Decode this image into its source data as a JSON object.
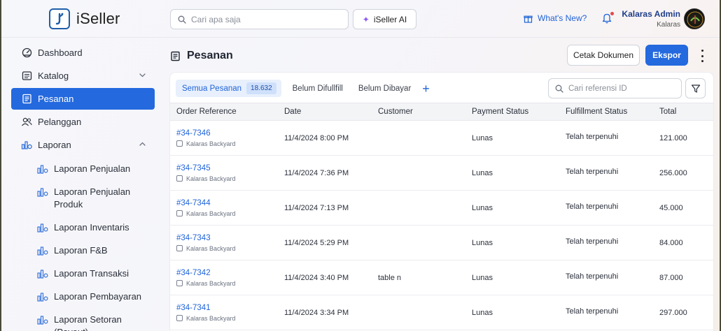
{
  "header": {
    "brand": "iSeller",
    "search_placeholder": "Cari apa saja",
    "ai_label": "iSeller AI",
    "whats_new": "What's New?",
    "user_name": "Kalaras Admin",
    "user_store": "Kalaras"
  },
  "sidebar": {
    "items": [
      {
        "label": "Dashboard",
        "icon": "dashboard-icon"
      },
      {
        "label": "Katalog",
        "icon": "catalog-icon"
      },
      {
        "label": "Pesanan",
        "icon": "orders-icon"
      },
      {
        "label": "Pelanggan",
        "icon": "customers-icon"
      },
      {
        "label": "Laporan",
        "icon": "reports-icon"
      }
    ],
    "reports": [
      {
        "label": "Laporan Penjualan"
      },
      {
        "label": "Laporan Penjualan Produk"
      },
      {
        "label": "Laporan Inventaris"
      },
      {
        "label": "Laporan F&B"
      },
      {
        "label": "Laporan Transaksi"
      },
      {
        "label": "Laporan Pembayaran"
      },
      {
        "label": "Laporan Setoran (Payout)"
      }
    ]
  },
  "page": {
    "title": "Pesanan",
    "print_button": "Cetak Dokumen",
    "export_button": "Ekspor"
  },
  "tabs": {
    "all": "Semua Pesanan",
    "all_count": "18.632",
    "unfulfilled": "Belum Difullfill",
    "unpaid": "Belum Dibayar",
    "add": "+"
  },
  "ref_search_placeholder": "Cari referensi ID",
  "table": {
    "headers": [
      "Order Reference",
      "Date",
      "Customer",
      "Payment Status",
      "Fulfillment Status",
      "Total"
    ],
    "rows": [
      {
        "ref": "#34-7346",
        "store": "Kalaras Backyard",
        "date": "11/4/2024 8:00 PM",
        "customer": "",
        "payment": "Lunas",
        "fulfillment": "Telah terpenuhi",
        "total": "121.000"
      },
      {
        "ref": "#34-7345",
        "store": "Kalaras Backyard",
        "date": "11/4/2024 7:36 PM",
        "customer": "",
        "payment": "Lunas",
        "fulfillment": "Telah terpenuhi",
        "total": "256.000"
      },
      {
        "ref": "#34-7344",
        "store": "Kalaras Backyard",
        "date": "11/4/2024 7:13 PM",
        "customer": "",
        "payment": "Lunas",
        "fulfillment": "Telah terpenuhi",
        "total": "45.000"
      },
      {
        "ref": "#34-7343",
        "store": "Kalaras Backyard",
        "date": "11/4/2024 5:29 PM",
        "customer": "",
        "payment": "Lunas",
        "fulfillment": "Telah terpenuhi",
        "total": "84.000"
      },
      {
        "ref": "#34-7342",
        "store": "Kalaras Backyard",
        "date": "11/4/2024 3:40 PM",
        "customer": "table n",
        "payment": "Lunas",
        "fulfillment": "Telah terpenuhi",
        "total": "87.000"
      },
      {
        "ref": "#34-7341",
        "store": "Kalaras Backyard",
        "date": "11/4/2024 3:34 PM",
        "customer": "",
        "payment": "Lunas",
        "fulfillment": "Telah terpenuhi",
        "total": "297.000"
      }
    ]
  },
  "colors": {
    "accent": "#2469de",
    "link": "#1f63d8",
    "brand_dark": "#1f3e8a"
  }
}
